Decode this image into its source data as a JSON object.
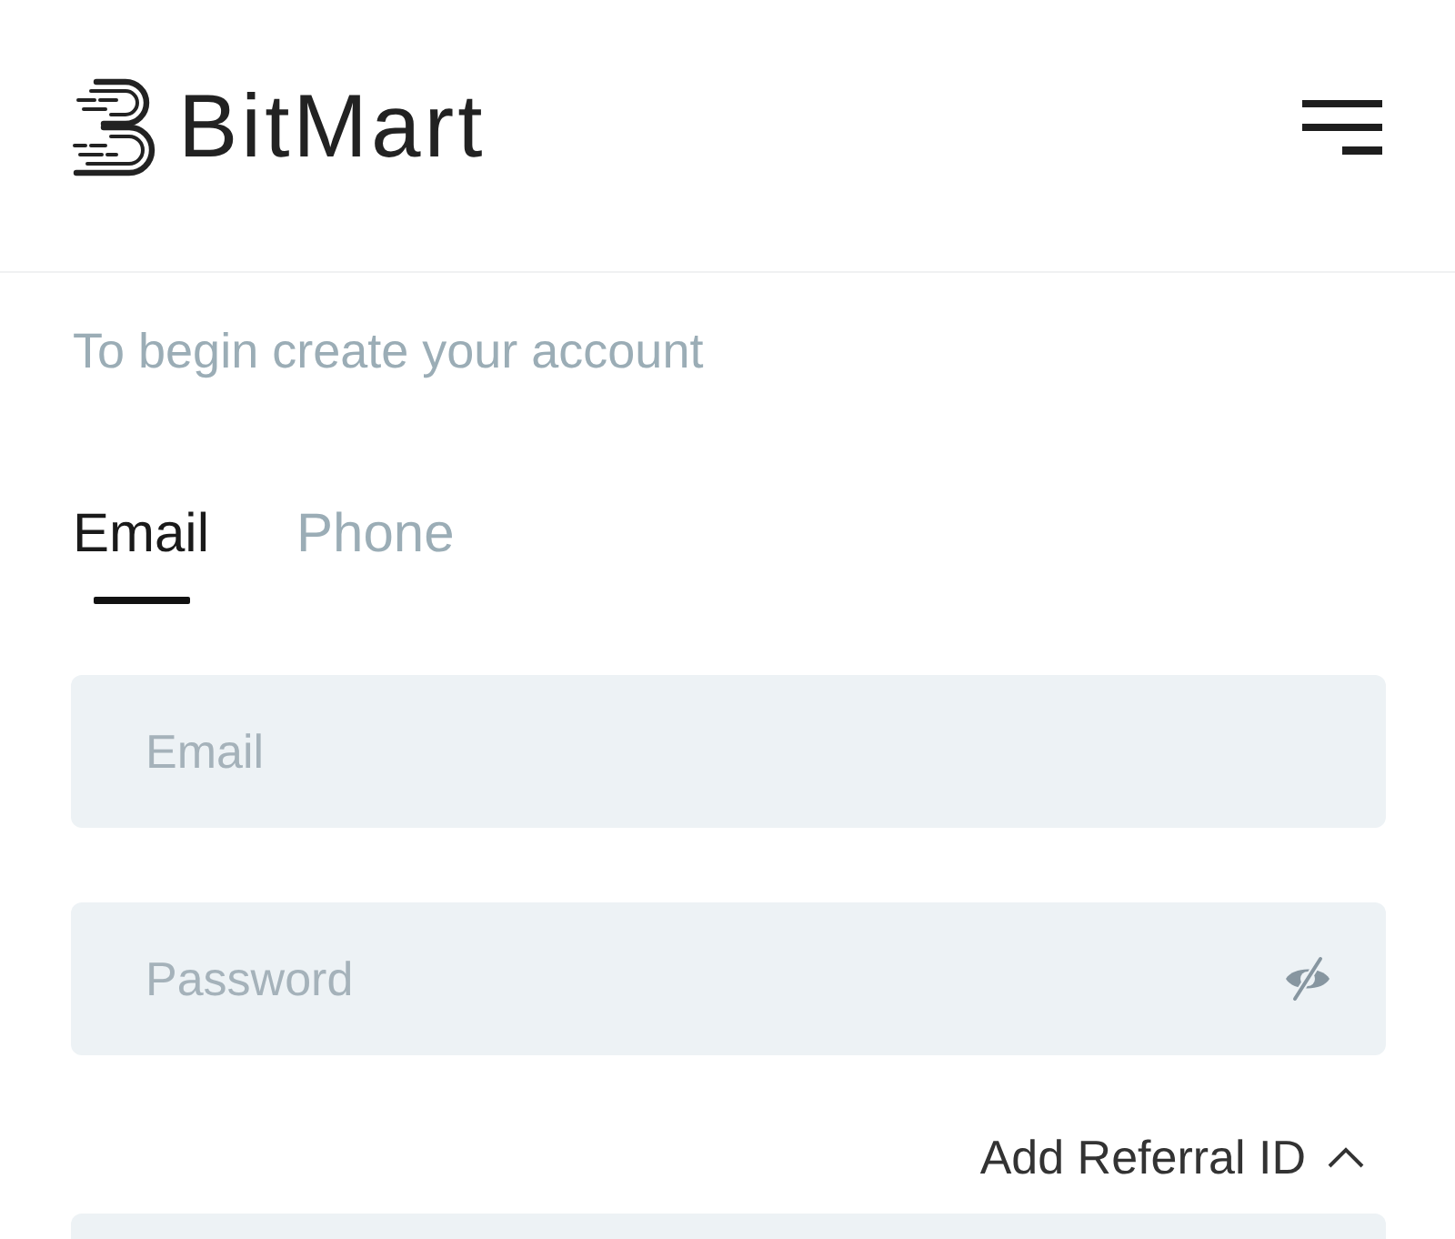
{
  "header": {
    "logo_text": "BitMart"
  },
  "subtitle": "To begin create your account",
  "tabs": [
    {
      "label": "Email",
      "selected": true
    },
    {
      "label": "Phone",
      "selected": false
    }
  ],
  "fields": [
    {
      "kind": "text",
      "placeholder": "Email"
    },
    {
      "kind": "password",
      "placeholder": "Password",
      "revealed": false
    }
  ],
  "referral": {
    "label": "Add Referral ID",
    "expanded": true
  }
}
